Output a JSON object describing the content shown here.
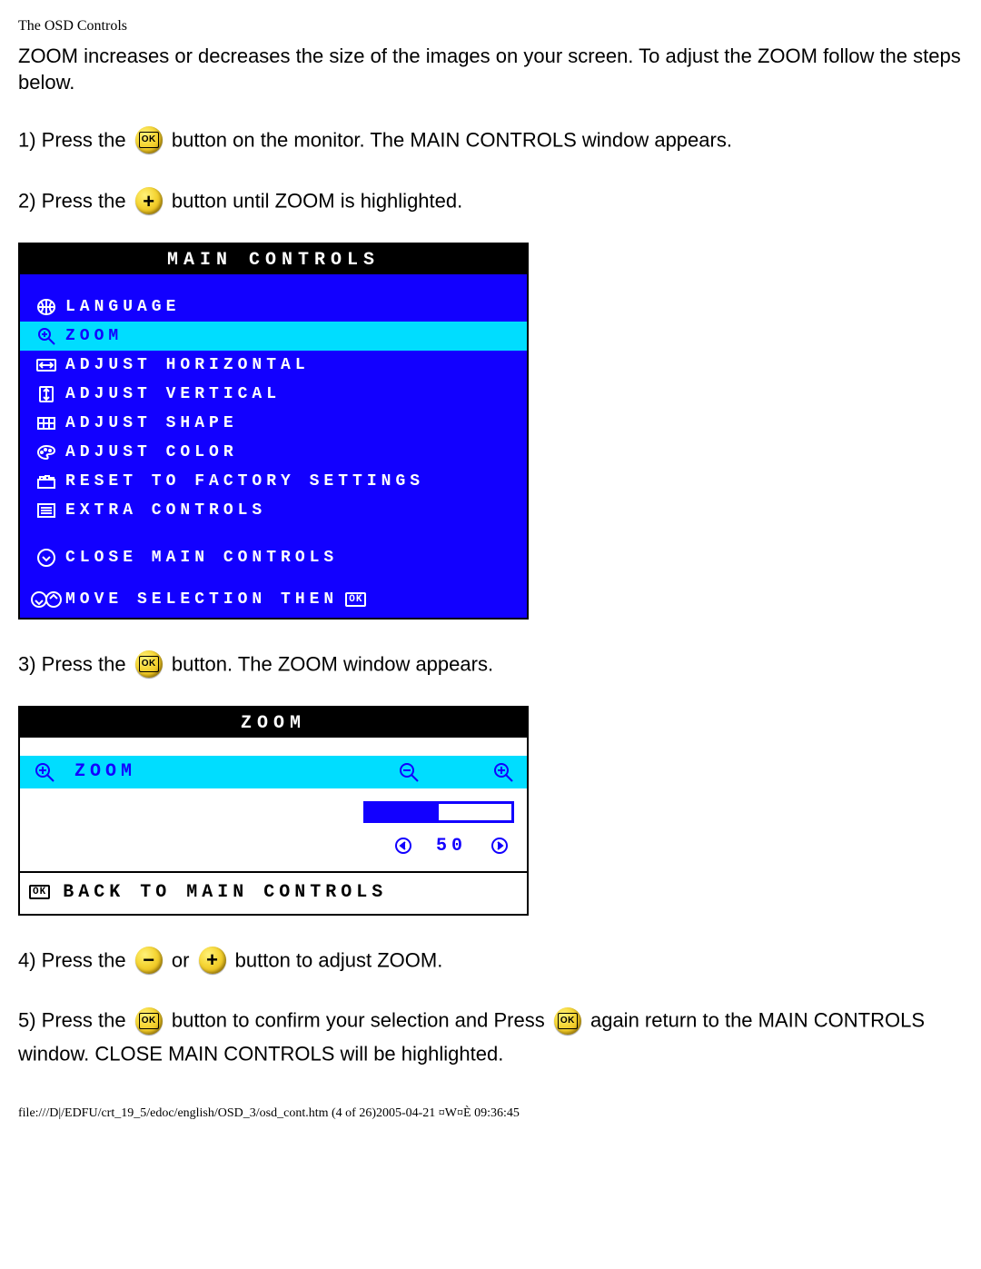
{
  "page_title": "The OSD Controls",
  "intro": "ZOOM increases or decreases the size of the images on your screen. To adjust the ZOOM follow the steps below.",
  "step1": {
    "prefix": "1) Press the ",
    "suffix": " button on the monitor. The MAIN CONTROLS window appears."
  },
  "step2": {
    "prefix": "2) Press the ",
    "suffix": " button until ZOOM is highlighted."
  },
  "step3": {
    "prefix": "3) Press the ",
    "suffix": " button. The ZOOM window appears."
  },
  "step4": {
    "prefix": "4) Press the ",
    "mid": " or ",
    "suffix": " button to adjust ZOOM."
  },
  "step5": {
    "prefix": "5) Press the ",
    "mid": " button to confirm your selection and Press ",
    "suffix": " again return to the MAIN CONTROLS window. CLOSE MAIN CONTROLS will be highlighted."
  },
  "osd": {
    "title": "MAIN CONTROLS",
    "items": [
      {
        "label": "LANGUAGE",
        "icon": "globe"
      },
      {
        "label": "ZOOM",
        "icon": "zoom",
        "highlight": true
      },
      {
        "label": "ADJUST HORIZONTAL",
        "icon": "horiz"
      },
      {
        "label": "ADJUST VERTICAL",
        "icon": "vert"
      },
      {
        "label": "ADJUST SHAPE",
        "icon": "shape"
      },
      {
        "label": "ADJUST COLOR",
        "icon": "palette"
      },
      {
        "label": "RESET TO FACTORY SETTINGS",
        "icon": "factory"
      },
      {
        "label": "EXTRA CONTROLS",
        "icon": "list"
      }
    ],
    "close": "CLOSE MAIN CONTROLS",
    "footer": "MOVE SELECTION THEN"
  },
  "zoom_osd": {
    "title": "ZOOM",
    "row_label": "ZOOM",
    "value": 50,
    "back_label": "BACK TO MAIN CONTROLS"
  },
  "footer_text": "file:///D|/EDFU/crt_19_5/edoc/english/OSD_3/osd_cont.htm (4 of 26)2005-04-21 ¤W¤È 09:36:45"
}
